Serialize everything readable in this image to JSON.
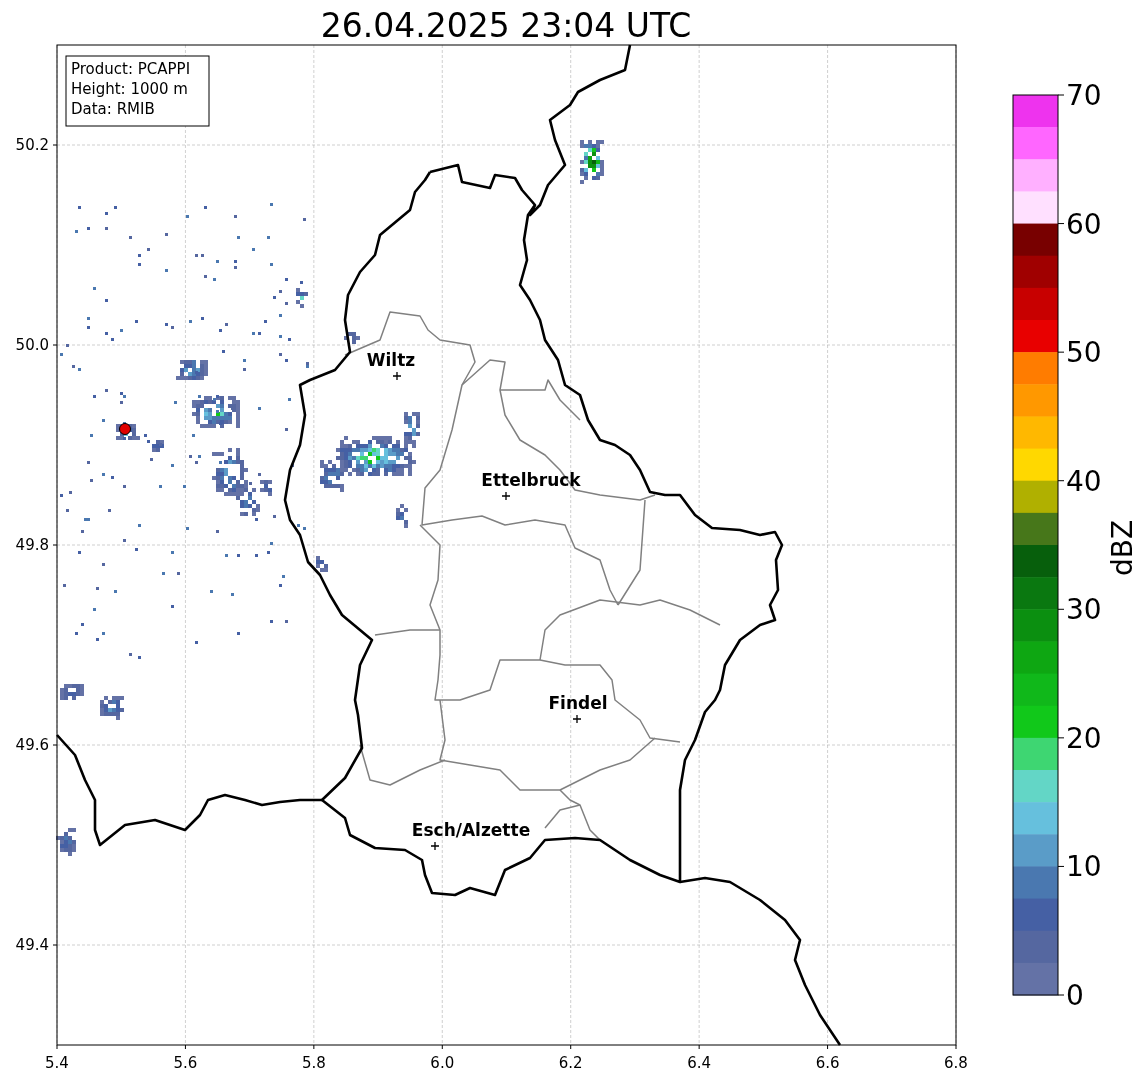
{
  "title": "26.04.2025 23:04 UTC",
  "info_box": [
    "Product: PCAPPI",
    "Height: 1000 m",
    "Data: RMIB"
  ],
  "map": {
    "x_ticks": [
      "5.4",
      "5.6",
      "5.8",
      "6.0",
      "6.2",
      "6.4",
      "6.6",
      "6.8"
    ],
    "y_ticks": [
      "50.2",
      "50.0",
      "49.8",
      "49.6",
      "49.4"
    ],
    "cities": [
      {
        "name": "Wiltz"
      },
      {
        "name": "Ettelbruck"
      },
      {
        "name": "Findel"
      },
      {
        "name": "Esch/Alzette"
      }
    ]
  },
  "colorbar": {
    "label": "dBZ",
    "ticks": [
      "70",
      "60",
      "50",
      "40",
      "30",
      "20",
      "10",
      "0"
    ],
    "segments": [
      {
        "color": "#ee33ee"
      },
      {
        "color": "#ff66ff"
      },
      {
        "color": "#ffb0ff"
      },
      {
        "color": "#ffe0ff"
      },
      {
        "color": "#780000"
      },
      {
        "color": "#a00000"
      },
      {
        "color": "#c80000"
      },
      {
        "color": "#e80000"
      },
      {
        "color": "#ff7c00"
      },
      {
        "color": "#ff9800"
      },
      {
        "color": "#ffb800"
      },
      {
        "color": "#ffd800"
      },
      {
        "color": "#b0b000"
      },
      {
        "color": "#47771a"
      },
      {
        "color": "#075f0c"
      },
      {
        "color": "#0a7810"
      },
      {
        "color": "#0b8f10"
      },
      {
        "color": "#0ea712"
      },
      {
        "color": "#10b81a"
      },
      {
        "color": "#11c81a"
      },
      {
        "color": "#3ed672"
      },
      {
        "color": "#63d6c6"
      },
      {
        "color": "#66c0dd"
      },
      {
        "color": "#5a9cc8"
      },
      {
        "color": "#4a78b0"
      },
      {
        "color": "#4560a4"
      },
      {
        "color": "#5567a0"
      },
      {
        "color": "#6472a6"
      }
    ]
  }
}
